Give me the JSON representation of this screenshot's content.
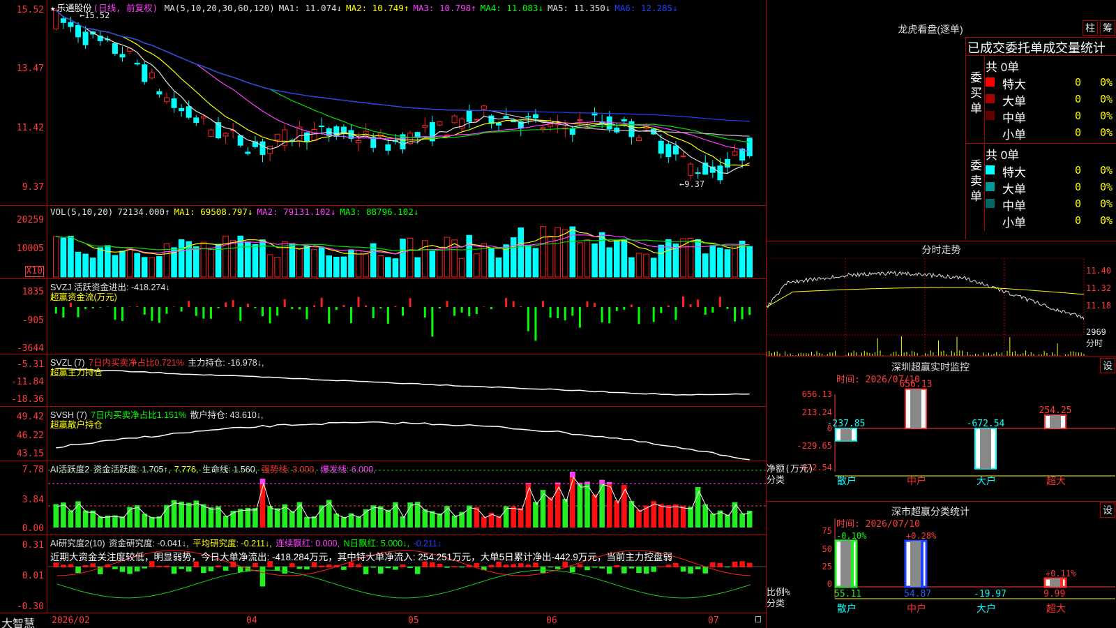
{
  "stock": {
    "name": "乐通股份",
    "period": "(日线, 前复权)"
  },
  "main_legend": [
    {
      "text": "MA(5,10,20,30,60,120)",
      "color": "#e0e0e0"
    },
    {
      "text": "MA1: 11.074↓",
      "color": "#e0e0e0"
    },
    {
      "text": "MA2: 10.749↑",
      "color": "#ffff00"
    },
    {
      "text": "MA3: 10.798↑",
      "color": "#ff40ff"
    },
    {
      "text": "MA4: 11.083↓",
      "color": "#00ff00"
    },
    {
      "text": "MA5: 11.350↓",
      "color": "#e0e0e0"
    },
    {
      "text": "MA6: 12.285↓",
      "color": "#2040ff"
    }
  ],
  "price_annotations": {
    "high": "15.52",
    "low": "9.37"
  },
  "price_axis": [
    "15.52",
    "13.47",
    "11.42",
    "9.37"
  ],
  "vol_legend": [
    {
      "text": "VOL(5,10,20)",
      "color": "#e0e0e0"
    },
    {
      "text": "72134.000↑",
      "color": "#e0e0e0"
    },
    {
      "text": "MA1: 69508.797↓",
      "color": "#ffff00"
    },
    {
      "text": "MA2: 79131.102↓",
      "color": "#ff40ff"
    },
    {
      "text": "MA3: 88796.102↓",
      "color": "#00ff00"
    }
  ],
  "vol_axis": [
    "20259",
    "10005",
    "X10"
  ],
  "svzj": {
    "legend": "SVZJ  活跃资金进出: -418.274↓",
    "sub": "超赢资金流(万元)",
    "axis": [
      "1835",
      "-905",
      "-3644"
    ]
  },
  "svzl": {
    "legend_a": "SVZL (7)",
    "legend_b": "7日内买卖净占比0.721%",
    "legend_c": "主力持仓: -16.978↓,",
    "sub": "超赢主力持仓",
    "axis": [
      "-5.31",
      "-11.84",
      "-18.36"
    ]
  },
  "svsh": {
    "legend_a": "SVSH (7)",
    "legend_b": "7日内买卖净占比1.151%",
    "legend_c": "散户持仓: 43.610↓,",
    "sub": "超赢散户持仓",
    "axis": [
      "49.42",
      "46.22",
      "43.15"
    ]
  },
  "ai1": {
    "a": "AI活跃度2",
    "b": "资金活跃度: 1.705↑,",
    "c": "7.776,",
    "d": "生命线: 1.560,",
    "e": "强势线: 3.000,",
    "f": "爆发线: 6.000,",
    "axis": [
      "7.78",
      "3.84",
      "0.00"
    ]
  },
  "ai2": {
    "a": "AI研究度2(10)",
    "b": "资金研究度: -0.041↓,",
    "c": "平均研究度: -0.211↓,",
    "d": "连续飘红: 0.000,",
    "e": "N日飘红: 5.000↓,",
    "f": "-0.211↓",
    "comment": "近期大资金关注度较低，明显弱势，今日大单净流出: -418.284万元，其中特大单净流入: 254.251万元，大单5日累计净出-442.9万元，当前主力控盘弱",
    "axis": [
      "0.31",
      "0.01",
      "-0.30"
    ]
  },
  "xaxis": [
    "2026/02",
    "04",
    "05",
    "06",
    "07"
  ],
  "brand": "大智慧",
  "dragon": {
    "title": "龙虎看盘(逐单)",
    "btn1": "柱",
    "btn2": "筹",
    "header": "已成交委托单成交量统计",
    "buy_label": "委买单",
    "sell_label": "委卖单",
    "buy_total": "共 0单",
    "sell_total": "共 0单",
    "buy": [
      {
        "name": "特大",
        "v": "0",
        "p": "0%",
        "c": "#ff0000"
      },
      {
        "name": "大单",
        "v": "0",
        "p": "0%",
        "c": "#aa0000"
      },
      {
        "name": "中单",
        "v": "0",
        "p": "0%",
        "c": "#660000"
      },
      {
        "name": "小单",
        "v": "0",
        "p": "0%",
        "c": ""
      }
    ],
    "sell": [
      {
        "name": "特大",
        "v": "0",
        "p": "0%",
        "c": "#00ffff"
      },
      {
        "name": "大单",
        "v": "0",
        "p": "0%",
        "c": "#009999"
      },
      {
        "name": "中单",
        "v": "0",
        "p": "0%",
        "c": "#006666"
      },
      {
        "name": "小单",
        "v": "0",
        "p": "0%",
        "c": ""
      }
    ]
  },
  "intraday": {
    "title": "分时走势",
    "axis": [
      "11.40",
      "11.32",
      "11.18"
    ],
    "vol_label": "2969",
    "unit": "分时"
  },
  "monitor": {
    "title": "深圳超赢实时监控",
    "btn": "设",
    "time": "时间: 2026/07/10",
    "axis": [
      "656.13",
      "213.24",
      "0",
      "-229.65",
      "-672.54"
    ],
    "ylabel": "净额(万元)",
    "xlabel": "分类",
    "cats": [
      "散户",
      "中户",
      "大户",
      "超大"
    ],
    "values": [
      -237.85,
      656.13,
      -672.54,
      254.25
    ],
    "labels": [
      "-237.85",
      "656.13",
      "-672.54",
      "254.25"
    ]
  },
  "classify": {
    "title": "深市超赢分类统计",
    "btn": "设",
    "time": "时间: 2026/07/10",
    "axis": [
      "75",
      "50",
      "25",
      "0"
    ],
    "ylabel": "比例%",
    "xlabel": "分类",
    "cats": [
      "散户",
      "中户",
      "大户",
      "超大"
    ],
    "top_labels": [
      "-0.10%",
      "+0.28%",
      "",
      "+0.11%"
    ],
    "bottom": [
      "55.11",
      "54.87",
      "-19.97",
      "9.99"
    ]
  },
  "chart_data": [
    {
      "type": "candlestick",
      "title": "乐通股份 (日线, 前复权)",
      "y_ticks": [
        15.52,
        13.47,
        11.42,
        9.37
      ],
      "high": 15.52,
      "low": 9.37,
      "ma": {
        "MA1": 11.074,
        "MA2": 10.749,
        "MA3": 10.798,
        "MA4": 11.083,
        "MA5": 11.35,
        "MA6": 12.285
      }
    },
    {
      "type": "bar",
      "title": "VOL(5,10,20)",
      "last": 72134.0,
      "ma": {
        "MA1": 69508.797,
        "MA2": 79131.102,
        "MA3": 88796.102
      },
      "y_ticks": [
        20259,
        10005
      ]
    },
    {
      "type": "bar",
      "title": "深圳超赢实时监控",
      "categories": [
        "散户",
        "中户",
        "大户",
        "超大"
      ],
      "values": [
        -237.85,
        656.13,
        -672.54,
        254.25
      ],
      "ylabel": "净额(万元)"
    },
    {
      "type": "bar",
      "title": "深市超赢分类统计",
      "categories": [
        "散户",
        "中户",
        "大户",
        "超大"
      ],
      "values": [
        55.11,
        54.87,
        -19.97,
        9.99
      ],
      "changes": [
        "-0.10%",
        "+0.28%",
        "",
        "+0.11%"
      ],
      "ylabel": "比例%"
    }
  ]
}
